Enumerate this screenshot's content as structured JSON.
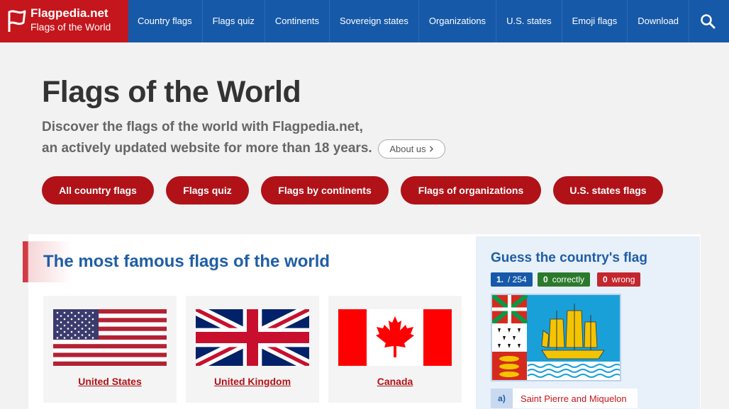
{
  "brand": {
    "name": "Flagpedia.net",
    "tagline": "Flags of the World"
  },
  "nav": [
    {
      "label": "Country flags"
    },
    {
      "label": "Flags quiz"
    },
    {
      "label": "Continents"
    },
    {
      "label": "Sovereign states"
    },
    {
      "label": "Organizations"
    },
    {
      "label": "U.S. states"
    },
    {
      "label": "Emoji flags"
    },
    {
      "label": "Download"
    }
  ],
  "hero": {
    "title": "Flags of the World",
    "subtitle_line1": "Discover the flags of the world with Flagpedia.net,",
    "subtitle_line2": "an actively updated website for more than 18 years.",
    "about_label": "About us"
  },
  "pills": [
    {
      "label": "All country flags"
    },
    {
      "label": "Flags quiz"
    },
    {
      "label": "Flags by continents"
    },
    {
      "label": "Flags of organizations"
    },
    {
      "label": "U.S. states flags"
    }
  ],
  "famous": {
    "title": "The most famous flags of the world",
    "flags": [
      {
        "name": "United States"
      },
      {
        "name": "United Kingdom"
      },
      {
        "name": "Canada"
      }
    ]
  },
  "quiz": {
    "title": "Guess the country's flag",
    "question_number": "1.",
    "question_total": "/ 254",
    "correct_count": "0",
    "correct_label": "correctly",
    "wrong_count": "0",
    "wrong_label": "wrong",
    "answers": [
      {
        "letter": "a)",
        "text": "Saint Pierre and Miquelon"
      }
    ]
  },
  "colors": {
    "nav_blue": "#1659a8",
    "brand_red": "#c4161c",
    "pill_red": "#b01218",
    "heading_blue": "#1f5ea6",
    "badge_blue": "#1659a8",
    "badge_green": "#2b7a2b",
    "badge_red": "#c4262e"
  },
  "icons": {
    "logo": "flag-logo-icon",
    "search": "search-icon",
    "chevron": "chevron-right-icon"
  }
}
